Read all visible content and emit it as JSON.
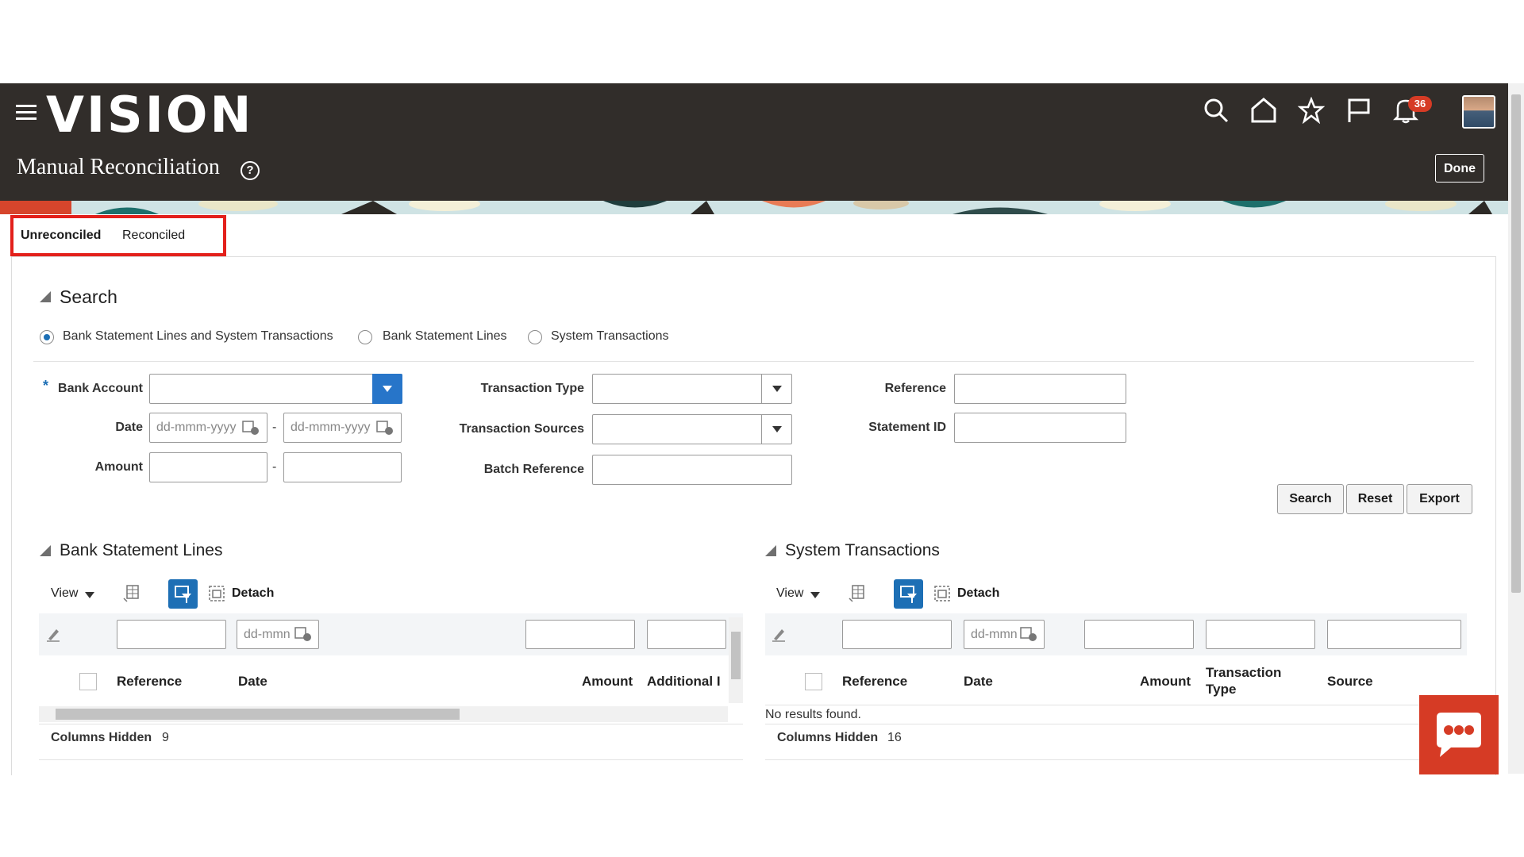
{
  "app": {
    "logo": "VISION",
    "page_title": "Manual Reconciliation",
    "help_icon": "?",
    "notification_count": "36",
    "done_label": "Done"
  },
  "header_icons": [
    "menu-icon",
    "search-icon",
    "home-icon",
    "favorites-star-icon",
    "flag-icon",
    "bell-icon",
    "user-avatar"
  ],
  "tabs": [
    {
      "label": "Unreconciled",
      "selected": true
    },
    {
      "label": "Reconciled",
      "selected": false
    }
  ],
  "search": {
    "title": "Search",
    "radios": [
      {
        "label": "Bank Statement Lines and System Transactions",
        "selected": true
      },
      {
        "label": "Bank Statement Lines",
        "selected": false
      },
      {
        "label": "System Transactions",
        "selected": false
      }
    ],
    "fields": {
      "bank_account": {
        "label": "Bank Account",
        "required": "*",
        "value": ""
      },
      "date": {
        "label": "Date",
        "from_placeholder": "dd-mmm-yyyy",
        "to_placeholder": "dd-mmm-yyyy",
        "separator": "-"
      },
      "amount": {
        "label": "Amount",
        "separator": "-"
      },
      "transaction_type": {
        "label": "Transaction Type",
        "value": ""
      },
      "transaction_sources": {
        "label": "Transaction Sources",
        "value": ""
      },
      "batch_reference": {
        "label": "Batch Reference",
        "value": ""
      },
      "reference": {
        "label": "Reference",
        "value": ""
      },
      "statement_id": {
        "label": "Statement ID",
        "value": ""
      }
    },
    "buttons": {
      "search": "Search",
      "reset": "Reset",
      "export": "Export"
    }
  },
  "bank_statement_lines": {
    "title": "Bank Statement Lines",
    "toolbar": {
      "view": "View",
      "detach": "Detach"
    },
    "filter_date_placeholder": "dd-mmn",
    "columns": [
      "Reference",
      "Date",
      "Amount",
      "Additional I"
    ],
    "columns_hidden_label": "Columns Hidden",
    "columns_hidden_count": "9"
  },
  "system_transactions": {
    "title": "System Transactions",
    "toolbar": {
      "view": "View",
      "detach": "Detach"
    },
    "filter_date_placeholder": "dd-mmn",
    "columns": [
      "Reference",
      "Date",
      "Amount",
      "Transaction Type",
      "Source"
    ],
    "empty_text": "No results found.",
    "columns_hidden_label": "Columns Hidden",
    "columns_hidden_count": "16"
  },
  "colors": {
    "header_bg": "#312d2a",
    "accent_blue": "#1d6fb5",
    "highlight_red": "#e3201b",
    "chat_red": "#d63b25"
  }
}
